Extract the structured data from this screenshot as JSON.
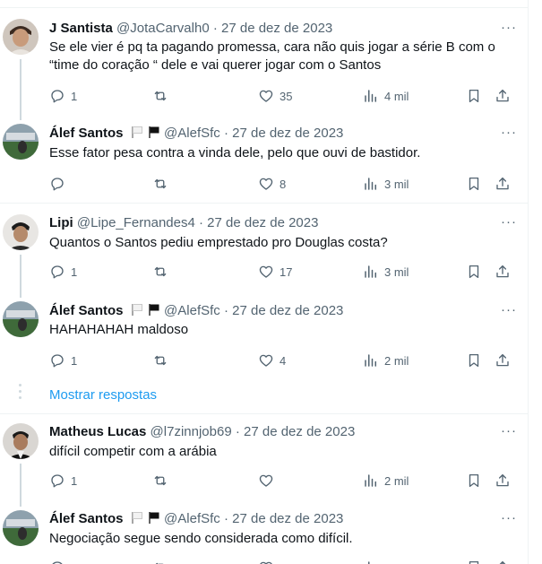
{
  "tweets": [
    {
      "name": "J Santista",
      "handle": "@JotaCarvalh0",
      "sep": "·",
      "date": "27 de dez de 2023",
      "text": "Se ele vier é pq ta pagando promessa, cara não quis jogar a série B com o “time do coração “ dele e vai querer jogar com o Santos",
      "replies": "1",
      "retweets": "",
      "likes": "35",
      "views": "4 mil",
      "more": "···"
    },
    {
      "name": "Álef Santos",
      "handle": "@AlefSfc",
      "sep": "·",
      "date": "27 de dez de 2023",
      "text": "Esse fator pesa contra a vinda dele, pelo que ouvi de bastidor.",
      "replies": "",
      "retweets": "",
      "likes": "8",
      "views": "3 mil",
      "more": "···"
    },
    {
      "name": "Lipi",
      "handle": "@Lipe_Fernandes4",
      "sep": "·",
      "date": "27 de dez de 2023",
      "text": "Quantos o Santos pediu emprestado pro Douglas costa?",
      "replies": "1",
      "retweets": "",
      "likes": "17",
      "views": "3 mil",
      "more": "···"
    },
    {
      "name": "Álef Santos",
      "handle": "@AlefSfc",
      "sep": "·",
      "date": "27 de dez de 2023",
      "text": "HAHAHAHAH maldoso",
      "replies": "1",
      "retweets": "",
      "likes": "4",
      "views": "2 mil",
      "more": "···"
    },
    {
      "name": "Matheus Lucas",
      "handle": "@l7zinnjob69",
      "sep": "·",
      "date": "27 de dez de 2023",
      "text": "difícil competir com a arábia",
      "replies": "1",
      "retweets": "",
      "likes": "",
      "views": "2 mil",
      "more": "···"
    },
    {
      "name": "Álef Santos",
      "handle": "@AlefSfc",
      "sep": "·",
      "date": "27 de dez de 2023",
      "text": "Negociação segue sendo considerada como difícil.",
      "replies": "",
      "retweets": "",
      "likes": "",
      "views": "",
      "more": "···"
    }
  ],
  "show_replies": "Mostrar respostas",
  "icons": {
    "reply": "reply-icon",
    "retweet": "retweet-icon",
    "like": "heart-icon",
    "views": "views-icon",
    "bookmark": "bookmark-icon",
    "share": "share-icon"
  },
  "colors": {
    "link": "#1d9bf0",
    "muted": "#536471",
    "text": "#0f1419"
  }
}
